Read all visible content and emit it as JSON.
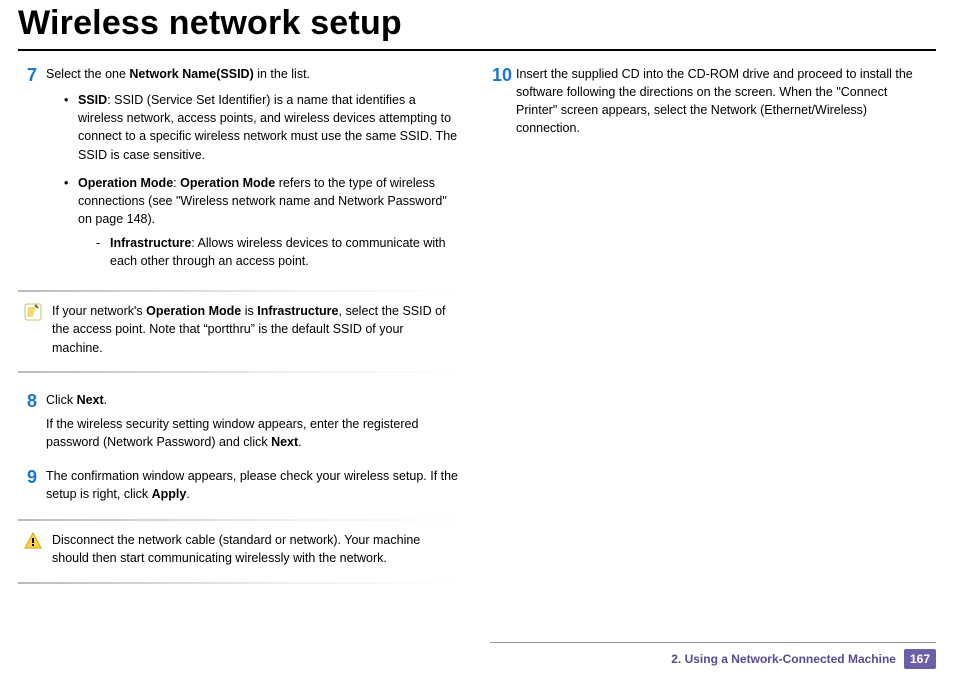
{
  "title": "Wireless network setup",
  "left": {
    "step7": {
      "num": "7",
      "intro_pre": "Select the one ",
      "intro_bold": "Network Name(SSID)",
      "intro_post": " in the list.",
      "ssid_label": "SSID",
      "ssid_text": ": SSID (Service Set Identifier) is a name that identifies a wireless network, access points, and wireless devices attempting to connect to a specific wireless network must use the same SSID. The SSID is case sensitive.",
      "opmode_label": "Operation Mode",
      "opmode_colon": ": ",
      "opmode_label2": "Operation Mode",
      "opmode_text": " refers to the type of wireless connections (see \"Wireless network name and Network Password\" on page 148).",
      "infra_label": "Infrastructure",
      "infra_text": ": Allows wireless devices to communicate with each other through an access point."
    },
    "note1_pre": "If your network's ",
    "note1_b1": "Operation Mode",
    "note1_mid": " is ",
    "note1_b2": "Infrastructure",
    "note1_post": ", select the SSID of the access point. Note that “portthru” is the default SSID of your machine.",
    "step8": {
      "num": "8",
      "line1_pre": "Click ",
      "line1_bold": "Next",
      "line1_post": ".",
      "line2_pre": "If the wireless security setting window appears, enter the registered password (Network Password) and click ",
      "line2_bold": "Next",
      "line2_post": "."
    },
    "step9": {
      "num": "9",
      "text_pre": "The confirmation window appears, please check your wireless setup. If the setup is right, click ",
      "text_bold": "Apply",
      "text_post": "."
    },
    "warn": "Disconnect the network cable (standard or network). Your machine should then start communicating wirelessly with the network."
  },
  "right": {
    "step10": {
      "num": "10",
      "text": "Insert the supplied CD into the CD-ROM drive and proceed to install the software following the directions on the screen. When the \"Connect Printer\" screen appears, select the Network (Ethernet/Wireless) connection."
    }
  },
  "footer": {
    "chapter": "2.  Using a Network-Connected Machine",
    "page": "167"
  }
}
